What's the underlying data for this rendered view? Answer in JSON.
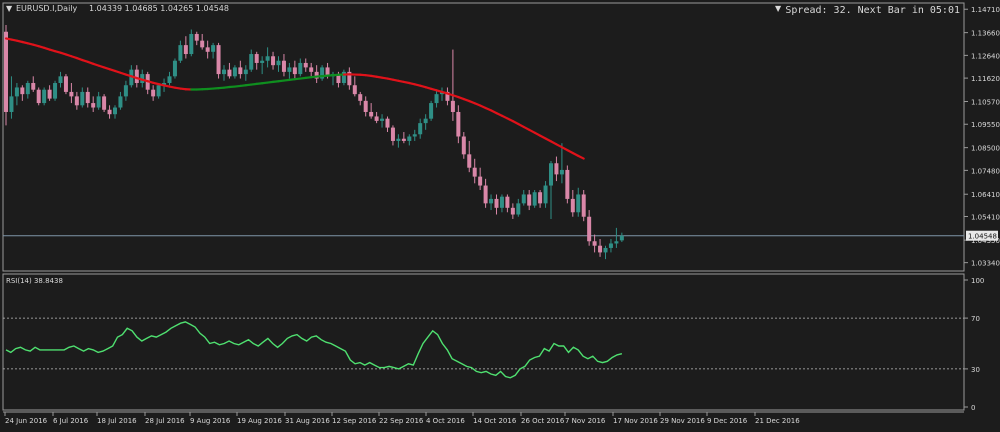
{
  "header": {
    "symbol_label": "EURUSD.I,Daily",
    "ohlc_label": "1.04339 1.04685 1.04265 1.04548",
    "spread_label": "Spread: 32. Next Bar in 05:01"
  },
  "colors": {
    "background": "#1c1c1c",
    "bull": "#2f8f86",
    "bear": "#d987a8",
    "ma_down": "#e0121a",
    "ma_up": "#0f8f1f",
    "rsi": "#4fe070",
    "axis_text": "#d8d8d8",
    "price_line": "#7f95a8"
  },
  "chart_data": [
    {
      "type": "candlestick",
      "title": "EURUSD.I,Daily",
      "y_axis_ticks": [
        "1.14710",
        "1.13660",
        "1.12640",
        "1.11620",
        "1.10570",
        "1.09550",
        "1.08500",
        "1.07480",
        "1.06410",
        "1.05410",
        "1.04350",
        "1.03340"
      ],
      "ylim": [
        1.031,
        1.149
      ],
      "current_price_label": "1.04548",
      "current_price": 1.04548,
      "x_axis_labels": [
        "24 Jun 2016",
        "6 Jul 2016",
        "18 Jul 2016",
        "28 Jul 2016",
        "9 Aug 2016",
        "19 Aug 2016",
        "31 Aug 2016",
        "12 Sep 2016",
        "22 Sep 2016",
        "4 Oct 2016",
        "14 Oct 2016",
        "26 Oct 2016",
        "7 Nov 2016",
        "17 Nov 2016",
        "29 Nov 2016",
        "9 Dec 2016",
        "21 Dec 2016"
      ],
      "candles": [
        {
          "o": 1.137,
          "h": 1.14,
          "l": 1.095,
          "c": 1.101
        },
        {
          "o": 1.101,
          "h": 1.117,
          "l": 1.098,
          "c": 1.108
        },
        {
          "o": 1.108,
          "h": 1.114,
          "l": 1.104,
          "c": 1.112
        },
        {
          "o": 1.112,
          "h": 1.113,
          "l": 1.106,
          "c": 1.109
        },
        {
          "o": 1.109,
          "h": 1.115,
          "l": 1.107,
          "c": 1.114
        },
        {
          "o": 1.114,
          "h": 1.117,
          "l": 1.11,
          "c": 1.111
        },
        {
          "o": 1.111,
          "h": 1.112,
          "l": 1.104,
          "c": 1.105
        },
        {
          "o": 1.105,
          "h": 1.112,
          "l": 1.104,
          "c": 1.111
        },
        {
          "o": 1.111,
          "h": 1.113,
          "l": 1.106,
          "c": 1.107
        },
        {
          "o": 1.107,
          "h": 1.115,
          "l": 1.106,
          "c": 1.114
        },
        {
          "o": 1.114,
          "h": 1.119,
          "l": 1.112,
          "c": 1.117
        },
        {
          "o": 1.117,
          "h": 1.118,
          "l": 1.109,
          "c": 1.11
        },
        {
          "o": 1.11,
          "h": 1.114,
          "l": 1.105,
          "c": 1.108
        },
        {
          "o": 1.108,
          "h": 1.11,
          "l": 1.102,
          "c": 1.104
        },
        {
          "o": 1.104,
          "h": 1.112,
          "l": 1.103,
          "c": 1.11
        },
        {
          "o": 1.11,
          "h": 1.112,
          "l": 1.103,
          "c": 1.105
        },
        {
          "o": 1.105,
          "h": 1.108,
          "l": 1.101,
          "c": 1.103
        },
        {
          "o": 1.103,
          "h": 1.11,
          "l": 1.102,
          "c": 1.108
        },
        {
          "o": 1.108,
          "h": 1.109,
          "l": 1.101,
          "c": 1.102
        },
        {
          "o": 1.102,
          "h": 1.104,
          "l": 1.098,
          "c": 1.1
        },
        {
          "o": 1.1,
          "h": 1.104,
          "l": 1.098,
          "c": 1.103
        },
        {
          "o": 1.103,
          "h": 1.11,
          "l": 1.102,
          "c": 1.108
        },
        {
          "o": 1.108,
          "h": 1.115,
          "l": 1.106,
          "c": 1.113
        },
        {
          "o": 1.113,
          "h": 1.122,
          "l": 1.112,
          "c": 1.12
        },
        {
          "o": 1.12,
          "h": 1.122,
          "l": 1.112,
          "c": 1.114
        },
        {
          "o": 1.114,
          "h": 1.12,
          "l": 1.112,
          "c": 1.118
        },
        {
          "o": 1.118,
          "h": 1.119,
          "l": 1.109,
          "c": 1.111
        },
        {
          "o": 1.111,
          "h": 1.113,
          "l": 1.106,
          "c": 1.108
        },
        {
          "o": 1.108,
          "h": 1.114,
          "l": 1.107,
          "c": 1.113
        },
        {
          "o": 1.113,
          "h": 1.116,
          "l": 1.11,
          "c": 1.114
        },
        {
          "o": 1.114,
          "h": 1.119,
          "l": 1.113,
          "c": 1.117
        },
        {
          "o": 1.117,
          "h": 1.125,
          "l": 1.116,
          "c": 1.124
        },
        {
          "o": 1.124,
          "h": 1.133,
          "l": 1.123,
          "c": 1.131
        },
        {
          "o": 1.131,
          "h": 1.135,
          "l": 1.125,
          "c": 1.127
        },
        {
          "o": 1.127,
          "h": 1.138,
          "l": 1.126,
          "c": 1.136
        },
        {
          "o": 1.136,
          "h": 1.137,
          "l": 1.131,
          "c": 1.133
        },
        {
          "o": 1.133,
          "h": 1.136,
          "l": 1.129,
          "c": 1.13
        },
        {
          "o": 1.13,
          "h": 1.133,
          "l": 1.125,
          "c": 1.128
        },
        {
          "o": 1.128,
          "h": 1.132,
          "l": 1.125,
          "c": 1.131
        },
        {
          "o": 1.131,
          "h": 1.132,
          "l": 1.116,
          "c": 1.118
        },
        {
          "o": 1.118,
          "h": 1.122,
          "l": 1.115,
          "c": 1.12
        },
        {
          "o": 1.12,
          "h": 1.123,
          "l": 1.116,
          "c": 1.117
        },
        {
          "o": 1.117,
          "h": 1.122,
          "l": 1.116,
          "c": 1.121
        },
        {
          "o": 1.121,
          "h": 1.124,
          "l": 1.116,
          "c": 1.118
        },
        {
          "o": 1.118,
          "h": 1.122,
          "l": 1.115,
          "c": 1.12
        },
        {
          "o": 1.12,
          "h": 1.129,
          "l": 1.119,
          "c": 1.127
        },
        {
          "o": 1.127,
          "h": 1.128,
          "l": 1.12,
          "c": 1.123
        },
        {
          "o": 1.123,
          "h": 1.126,
          "l": 1.118,
          "c": 1.124
        },
        {
          "o": 1.124,
          "h": 1.13,
          "l": 1.121,
          "c": 1.126
        },
        {
          "o": 1.126,
          "h": 1.128,
          "l": 1.12,
          "c": 1.122
        },
        {
          "o": 1.122,
          "h": 1.126,
          "l": 1.119,
          "c": 1.124
        },
        {
          "o": 1.124,
          "h": 1.127,
          "l": 1.117,
          "c": 1.119
        },
        {
          "o": 1.119,
          "h": 1.123,
          "l": 1.116,
          "c": 1.121
        },
        {
          "o": 1.121,
          "h": 1.124,
          "l": 1.116,
          "c": 1.118
        },
        {
          "o": 1.118,
          "h": 1.125,
          "l": 1.117,
          "c": 1.123
        },
        {
          "o": 1.123,
          "h": 1.125,
          "l": 1.119,
          "c": 1.121
        },
        {
          "o": 1.121,
          "h": 1.123,
          "l": 1.117,
          "c": 1.119
        },
        {
          "o": 1.119,
          "h": 1.122,
          "l": 1.114,
          "c": 1.116
        },
        {
          "o": 1.116,
          "h": 1.122,
          "l": 1.115,
          "c": 1.121
        },
        {
          "o": 1.121,
          "h": 1.123,
          "l": 1.116,
          "c": 1.117
        },
        {
          "o": 1.117,
          "h": 1.119,
          "l": 1.113,
          "c": 1.118
        },
        {
          "o": 1.118,
          "h": 1.119,
          "l": 1.112,
          "c": 1.114
        },
        {
          "o": 1.114,
          "h": 1.12,
          "l": 1.113,
          "c": 1.119
        },
        {
          "o": 1.119,
          "h": 1.121,
          "l": 1.111,
          "c": 1.113
        },
        {
          "o": 1.113,
          "h": 1.117,
          "l": 1.108,
          "c": 1.109
        },
        {
          "o": 1.109,
          "h": 1.11,
          "l": 1.104,
          "c": 1.106
        },
        {
          "o": 1.106,
          "h": 1.108,
          "l": 1.099,
          "c": 1.101
        },
        {
          "o": 1.101,
          "h": 1.105,
          "l": 1.098,
          "c": 1.099
        },
        {
          "o": 1.099,
          "h": 1.101,
          "l": 1.096,
          "c": 1.097
        },
        {
          "o": 1.097,
          "h": 1.1,
          "l": 1.094,
          "c": 1.098
        },
        {
          "o": 1.098,
          "h": 1.099,
          "l": 1.092,
          "c": 1.094
        },
        {
          "o": 1.094,
          "h": 1.095,
          "l": 1.086,
          "c": 1.088
        },
        {
          "o": 1.088,
          "h": 1.091,
          "l": 1.085,
          "c": 1.089
        },
        {
          "o": 1.089,
          "h": 1.092,
          "l": 1.087,
          "c": 1.088
        },
        {
          "o": 1.088,
          "h": 1.091,
          "l": 1.086,
          "c": 1.09
        },
        {
          "o": 1.09,
          "h": 1.093,
          "l": 1.088,
          "c": 1.091
        },
        {
          "o": 1.091,
          "h": 1.098,
          "l": 1.089,
          "c": 1.096
        },
        {
          "o": 1.096,
          "h": 1.1,
          "l": 1.093,
          "c": 1.098
        },
        {
          "o": 1.098,
          "h": 1.106,
          "l": 1.097,
          "c": 1.105
        },
        {
          "o": 1.105,
          "h": 1.111,
          "l": 1.103,
          "c": 1.109
        },
        {
          "o": 1.109,
          "h": 1.112,
          "l": 1.106,
          "c": 1.11
        },
        {
          "o": 1.11,
          "h": 1.112,
          "l": 1.104,
          "c": 1.106
        },
        {
          "o": 1.106,
          "h": 1.129,
          "l": 1.097,
          "c": 1.101
        },
        {
          "o": 1.101,
          "h": 1.104,
          "l": 1.087,
          "c": 1.09
        },
        {
          "o": 1.09,
          "h": 1.092,
          "l": 1.08,
          "c": 1.082
        },
        {
          "o": 1.082,
          "h": 1.088,
          "l": 1.074,
          "c": 1.076
        },
        {
          "o": 1.076,
          "h": 1.08,
          "l": 1.069,
          "c": 1.072
        },
        {
          "o": 1.072,
          "h": 1.076,
          "l": 1.066,
          "c": 1.068
        },
        {
          "o": 1.068,
          "h": 1.071,
          "l": 1.058,
          "c": 1.06
        },
        {
          "o": 1.06,
          "h": 1.064,
          "l": 1.057,
          "c": 1.062
        },
        {
          "o": 1.062,
          "h": 1.064,
          "l": 1.055,
          "c": 1.058
        },
        {
          "o": 1.058,
          "h": 1.064,
          "l": 1.056,
          "c": 1.063
        },
        {
          "o": 1.063,
          "h": 1.064,
          "l": 1.056,
          "c": 1.058
        },
        {
          "o": 1.058,
          "h": 1.06,
          "l": 1.053,
          "c": 1.055
        },
        {
          "o": 1.055,
          "h": 1.062,
          "l": 1.054,
          "c": 1.06
        },
        {
          "o": 1.06,
          "h": 1.066,
          "l": 1.059,
          "c": 1.064
        },
        {
          "o": 1.064,
          "h": 1.066,
          "l": 1.057,
          "c": 1.059
        },
        {
          "o": 1.059,
          "h": 1.066,
          "l": 1.058,
          "c": 1.065
        },
        {
          "o": 1.065,
          "h": 1.066,
          "l": 1.058,
          "c": 1.06
        },
        {
          "o": 1.06,
          "h": 1.07,
          "l": 1.058,
          "c": 1.068
        },
        {
          "o": 1.068,
          "h": 1.079,
          "l": 1.053,
          "c": 1.078
        },
        {
          "o": 1.078,
          "h": 1.081,
          "l": 1.07,
          "c": 1.073
        },
        {
          "o": 1.073,
          "h": 1.087,
          "l": 1.069,
          "c": 1.075
        },
        {
          "o": 1.075,
          "h": 1.077,
          "l": 1.06,
          "c": 1.062
        },
        {
          "o": 1.062,
          "h": 1.066,
          "l": 1.054,
          "c": 1.056
        },
        {
          "o": 1.056,
          "h": 1.067,
          "l": 1.054,
          "c": 1.064
        },
        {
          "o": 1.064,
          "h": 1.066,
          "l": 1.052,
          "c": 1.054
        },
        {
          "o": 1.054,
          "h": 1.057,
          "l": 1.041,
          "c": 1.043
        },
        {
          "o": 1.043,
          "h": 1.046,
          "l": 1.038,
          "c": 1.041
        },
        {
          "o": 1.041,
          "h": 1.044,
          "l": 1.036,
          "c": 1.038
        },
        {
          "o": 1.038,
          "h": 1.041,
          "l": 1.035,
          "c": 1.04
        },
        {
          "o": 1.04,
          "h": 1.044,
          "l": 1.038,
          "c": 1.042
        },
        {
          "o": 1.042,
          "h": 1.049,
          "l": 1.04,
          "c": 1.043
        },
        {
          "o": 1.04339,
          "h": 1.04685,
          "l": 1.04265,
          "c": 1.04548
        }
      ],
      "moving_average": [
        1.134,
        1.1335,
        1.133,
        1.1324,
        1.1318,
        1.1312,
        1.1305,
        1.1298,
        1.129,
        1.1283,
        1.1276,
        1.1268,
        1.126,
        1.1252,
        1.1243,
        1.1235,
        1.1226,
        1.1218,
        1.121,
        1.1202,
        1.1194,
        1.1186,
        1.1178,
        1.117,
        1.1162,
        1.1155,
        1.1148,
        1.1141,
        1.1135,
        1.1129,
        1.1124,
        1.1119,
        1.1115,
        1.1112,
        1.1111,
        1.1111,
        1.1112,
        1.1113,
        1.1115,
        1.1117,
        1.1119,
        1.1122,
        1.1124,
        1.1127,
        1.113,
        1.1133,
        1.1136,
        1.1139,
        1.1142,
        1.1145,
        1.1148,
        1.1151,
        1.1154,
        1.1157,
        1.116,
        1.1163,
        1.1166,
        1.1169,
        1.1171,
        1.1173,
        1.1175,
        1.1177,
        1.1178,
        1.1179,
        1.1178,
        1.1177,
        1.1175,
        1.1172,
        1.1168,
        1.1164,
        1.116,
        1.1155,
        1.115,
        1.1145,
        1.114,
        1.1134,
        1.1128,
        1.1121,
        1.1114,
        1.1107,
        1.11,
        1.1093,
        1.1085,
        1.1077,
        1.1068,
        1.1059,
        1.1049,
        1.1039,
        1.1028,
        1.1017,
        1.1005,
        1.0993,
        1.0981,
        1.0969,
        1.0956,
        1.0943,
        1.093,
        1.0917,
        1.0904,
        1.0891,
        1.0878,
        1.0865,
        1.0852,
        1.0839,
        1.0826,
        1.0813,
        1.0801
      ],
      "ma_trend": [
        "down",
        "down",
        "down",
        "down",
        "down",
        "down",
        "down",
        "down",
        "down",
        "down",
        "down",
        "down",
        "down",
        "down",
        "down",
        "down",
        "down",
        "down",
        "down",
        "down",
        "down",
        "down",
        "down",
        "down",
        "down",
        "down",
        "down",
        "down",
        "down",
        "down",
        "down",
        "down",
        "down",
        "down",
        "down",
        "up",
        "up",
        "up",
        "up",
        "up",
        "up",
        "up",
        "up",
        "up",
        "up",
        "up",
        "up",
        "up",
        "up",
        "up",
        "up",
        "up",
        "up",
        "up",
        "up",
        "up",
        "up",
        "up",
        "up",
        "up",
        "up",
        "up",
        "up",
        "down",
        "down",
        "down",
        "down",
        "down",
        "down",
        "down",
        "down",
        "down",
        "down",
        "down",
        "down",
        "down",
        "down",
        "down",
        "down",
        "down",
        "down",
        "down",
        "down",
        "down",
        "down",
        "down",
        "down",
        "down",
        "down",
        "down",
        "down",
        "down",
        "down",
        "down",
        "down",
        "down",
        "down",
        "down",
        "down",
        "down",
        "down",
        "down",
        "down",
        "down",
        "down",
        "down",
        "down"
      ]
    },
    {
      "type": "line",
      "title": "RSI(14) 38.8438",
      "ylim": [
        0,
        100
      ],
      "y_axis_ticks": [
        "100",
        "70",
        "30",
        "0"
      ],
      "levels": [
        70,
        30
      ],
      "series": [
        {
          "values": [
            45,
            43,
            46,
            47,
            45,
            44,
            47,
            45,
            45,
            45,
            45,
            45,
            45,
            47,
            48,
            46,
            44,
            46,
            45,
            43,
            44,
            46,
            48,
            55,
            57,
            62,
            60,
            55,
            52,
            54,
            56,
            55,
            57,
            59,
            62,
            64,
            66,
            67,
            65,
            63,
            58,
            55,
            50,
            51,
            49,
            50,
            52,
            50,
            49,
            51,
            53,
            50,
            48,
            51,
            54,
            50,
            47,
            50,
            54,
            56,
            57,
            54,
            52,
            55,
            56,
            53,
            51,
            50,
            48,
            46,
            44,
            37,
            34,
            35,
            33,
            35,
            33,
            31,
            31,
            32,
            31,
            30,
            32,
            34,
            33,
            42,
            50,
            55,
            60,
            57,
            50,
            45,
            38,
            36,
            34,
            32,
            31,
            28,
            27,
            28,
            26,
            25,
            28,
            24,
            23,
            25,
            30,
            32,
            37,
            39,
            40,
            46,
            44,
            50,
            48,
            48,
            43,
            47,
            45,
            40,
            38,
            40,
            36,
            35,
            36,
            39,
            41,
            42
          ]
        }
      ]
    }
  ]
}
